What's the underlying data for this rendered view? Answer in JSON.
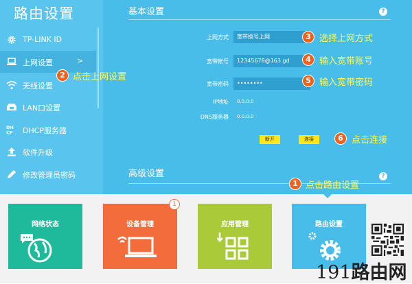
{
  "app_title": "路由设置",
  "sidebar": {
    "items": [
      {
        "label": "TP-LINK ID",
        "icon": "gear-icon"
      },
      {
        "label": "上网设置",
        "icon": "laptop-icon",
        "arrow": ">"
      },
      {
        "label": "无线设置",
        "icon": "wifi-icon"
      },
      {
        "label": "LAN口设置",
        "icon": "network-icon"
      },
      {
        "label": "DHCP服务器",
        "icon": "dhcp-icon"
      },
      {
        "label": "软件升级",
        "icon": "upload-icon"
      },
      {
        "label": "修改管理员密码",
        "icon": "pencil-icon"
      }
    ]
  },
  "basic": {
    "title": "基本设置",
    "help": "?",
    "connection_type_label": "上网方式",
    "connection_type_value": "宽带拨号上网",
    "account_label": "宽带帐号",
    "account_value": "12345678@163.gd",
    "password_label": "宽带密码",
    "password_value": "••••••••",
    "ip_label": "IP地址",
    "ip_value": "0.0.0.0",
    "dns_label": "DNS服务器",
    "dns_value": "0.0.0.0",
    "disconnect_label": "断开",
    "connect_label": "连接"
  },
  "advanced": {
    "title": "高级设置",
    "help": "?"
  },
  "annotations": [
    {
      "num": "1",
      "text": "点击路由设置"
    },
    {
      "num": "2",
      "text": "点击上网设置"
    },
    {
      "num": "3",
      "text": "选择上网方式"
    },
    {
      "num": "4",
      "text": "输入宽带账号"
    },
    {
      "num": "5",
      "text": "输入宽带密码"
    },
    {
      "num": "6",
      "text": "点击连接"
    }
  ],
  "tiles": [
    {
      "label": "网络状态",
      "color": "#1fb99b",
      "icon": "globe-icon"
    },
    {
      "label": "设备管理",
      "color": "#f26d3b",
      "icon": "laptop-wifi-icon",
      "badge": "1"
    },
    {
      "label": "应用管理",
      "color": "#a9cb3a",
      "icon": "apps-grid-icon"
    },
    {
      "label": "路由设置",
      "color": "#49bde9",
      "icon": "settings-gear-icon"
    }
  ],
  "watermark": {
    "num": "191",
    "text": "路由网"
  },
  "colors": {
    "top_bg": "#49bde9",
    "sidebar_bg": "#59c5ee",
    "badge": "#f0611d",
    "annotation_text": "#fff95a",
    "button": "#ffe61b"
  }
}
